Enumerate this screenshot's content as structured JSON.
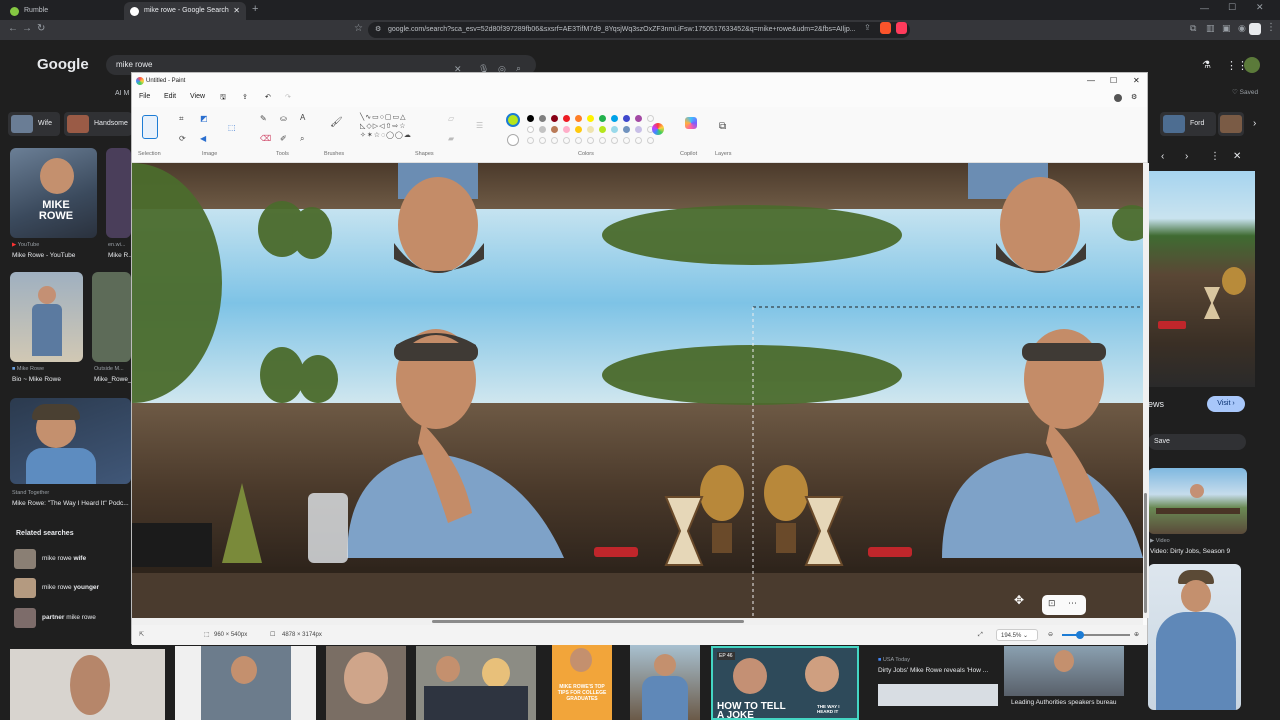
{
  "browser": {
    "tabs": [
      {
        "label": "Rumble",
        "active": false
      },
      {
        "label": "mike rowe - Google Search",
        "active": true
      }
    ],
    "url": "google.com/search?sca_esv=52d80f397289fb06&sxsrf=AE3TifM7d9_8YqsjWq3szOxZF3nmLiFsw:1750517633452&q=mike+rowe&udm=2&fbs=AIljp..."
  },
  "google": {
    "logo": "Google",
    "query": "mike rowe",
    "ai_mode": "AI M",
    "saved": "Saved",
    "chips": [
      {
        "label": "Wife"
      },
      {
        "label": "Handsome"
      },
      {
        "label": "Ford"
      }
    ],
    "results": [
      {
        "overlay": "MIKE ROWE",
        "source": "YouTube",
        "title": "Mike Rowe - YouTube"
      },
      {
        "source": "en.wi...",
        "title": "Mike R..."
      },
      {
        "source": "Mike Rowe",
        "title": "Bio ~ Mike Rowe"
      },
      {
        "source": "Outside M...",
        "title": "Mike_Rowe_..."
      },
      {
        "source": "Stand Together",
        "title": "Mike Rowe: \"The Way I Heard It\" Podc..."
      }
    ],
    "related": {
      "heading": "Related searches",
      "items": [
        {
          "prefix": "mike rowe ",
          "bold": "wife"
        },
        {
          "prefix": "mike rowe ",
          "bold": "younger"
        },
        {
          "prefix": "partner",
          "bold": " mike rowe"
        }
      ]
    },
    "side_panel": {
      "news_fragment": "ews",
      "visit": "Visit",
      "save": "Save",
      "video_source": "Video",
      "video_title": "Video: Dirty Jobs, Season 9"
    },
    "bottom": {
      "usa_today_source": "USA Today",
      "usa_today_title": "Dirty Jobs' Mike Rowe reveals 'How ...",
      "leading_title": "Leading Authorities speakers bureau",
      "tips_overlay": "MIKE ROWE'S TOP TIPS FOR COLLEGE GRADUATES",
      "joke_overlay": "HOW TO TELL A JOKE",
      "way_overlay": "THE WAY I HEARD IT",
      "ep_badge": "EP 46"
    }
  },
  "paint": {
    "title": "Untitled - Paint",
    "menu": [
      "File",
      "Edit",
      "View"
    ],
    "groups": [
      "Selection",
      "Image",
      "Tools",
      "Brushes",
      "Shapes",
      "Colors",
      "Copilot",
      "Layers"
    ],
    "status": {
      "selection_size": "960 × 540px",
      "canvas_size": "4878 × 3174px",
      "zoom": "194.5%"
    },
    "palette_row1": [
      "#000000",
      "#7f7f7f",
      "#880015",
      "#ed1c24",
      "#ff7f27",
      "#fff200",
      "#22b14c",
      "#00a2e8",
      "#3f48cc",
      "#a349a4"
    ],
    "palette_row2": [
      "#ffffff",
      "#c3c3c3",
      "#b97a57",
      "#ffaec9",
      "#ffc90e",
      "#efe4b0",
      "#b5e61d",
      "#99d9ea",
      "#7092be",
      "#c8bfe7"
    ],
    "selected_color": "#b5e61d"
  }
}
